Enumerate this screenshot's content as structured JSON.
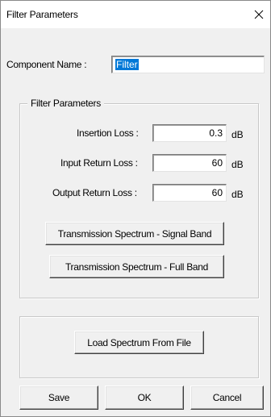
{
  "window": {
    "title": "Filter Parameters",
    "close_glyph": "✕"
  },
  "component": {
    "label": "Component Name :",
    "value": "Filter"
  },
  "filter_group": {
    "title": "Filter Parameters",
    "insertion_loss": {
      "label": "Insertion Loss :",
      "value": "0.3",
      "unit": "dB"
    },
    "input_return_loss": {
      "label": "Input Return Loss :",
      "value": "60",
      "unit": "dB"
    },
    "output_return_loss": {
      "label": "Output Return Loss :",
      "value": "60",
      "unit": "dB"
    },
    "signal_band_button": "Transmission Spectrum - Signal Band",
    "full_band_button": "Transmission Spectrum - Full Band"
  },
  "load_group": {
    "load_button": "Load Spectrum From File"
  },
  "footer": {
    "save": "Save",
    "ok": "OK",
    "cancel": "Cancel"
  }
}
